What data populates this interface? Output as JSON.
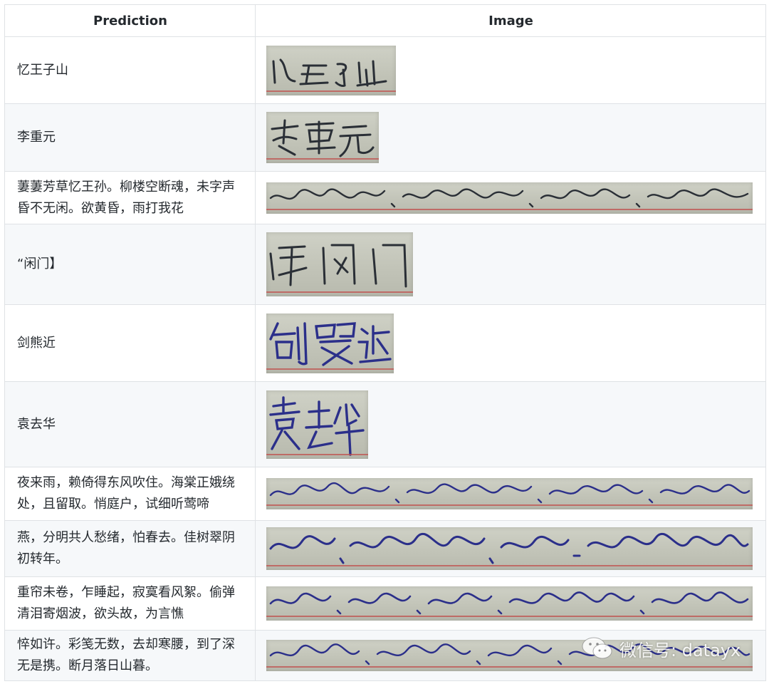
{
  "table": {
    "headers": [
      "Prediction",
      "Image"
    ],
    "rows": [
      {
        "prediction": "忆王子山"
      },
      {
        "prediction": "李重元"
      },
      {
        "prediction": "萋萋芳草忆王孙。柳楼空断魂，未字声昏不无闲。欲黄昏，雨打我花"
      },
      {
        "prediction": "“闲门】"
      },
      {
        "prediction": "剑熊近"
      },
      {
        "prediction": "袁去华"
      },
      {
        "prediction": "夜来雨，赖倚得东风吹住。海棠正娥绕处，且留取。悄庭户，试细听莺啼"
      },
      {
        "prediction": "燕，分明共人愁绪，怕春去。佳树翠阴初转年。"
      },
      {
        "prediction": "重帘未卷，乍睡起，寂寞看风絮。偷弹清泪寄烟波，欲头故，为言憔"
      },
      {
        "prediction": "悴如许。彩笺无数，去却寒腰，到了深无是携。断月落日山暮。"
      }
    ]
  },
  "watermark": {
    "text": "微信号: datayx",
    "icon": "wechat-icon"
  }
}
